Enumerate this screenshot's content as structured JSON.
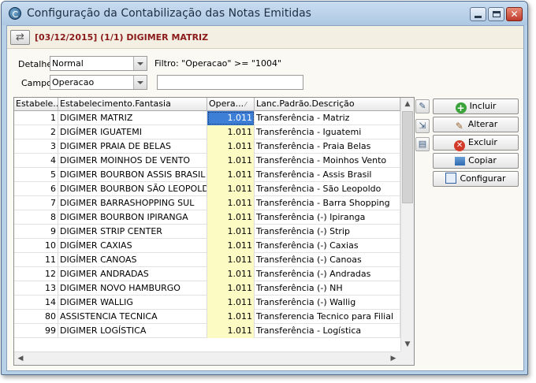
{
  "window": {
    "title": "Configuração da Contabilização das Notas Emitidas"
  },
  "header": {
    "title": "[03/12/2015] (1/1) DIGIMER MATRIZ"
  },
  "filters": {
    "detalhe_label": "Detalhe",
    "detalhe_value": "Normal",
    "filtro_text": "Filtro: \"Operacao\" >= \"1004\"",
    "campo_label": "Campo",
    "campo_value": "Operacao",
    "search_value": ""
  },
  "grid": {
    "columns": [
      "Estabele...",
      "Estabelecimento.Fantasia",
      "Opera...",
      "Lanc.Padrão.Descrição"
    ],
    "rows": [
      {
        "est": "1",
        "fantasia": "DIGIMER MATRIZ",
        "op": "1.011",
        "desc": "Transferência - Matriz"
      },
      {
        "est": "2",
        "fantasia": "DIGÍMER IGUATEMI",
        "op": "1.011",
        "desc": "Transferência - Iguatemi"
      },
      {
        "est": "3",
        "fantasia": "DIGIMER PRAIA DE BELAS",
        "op": "1.011",
        "desc": "Transferência - Praia Belas"
      },
      {
        "est": "4",
        "fantasia": "DIGIMER MOINHOS DE VENTO",
        "op": "1.011",
        "desc": "Transferência - Moinhos Vento"
      },
      {
        "est": "5",
        "fantasia": "DIGIMER BOURBON ASSIS BRASIL",
        "op": "1.011",
        "desc": "Transferência - Assis Brasil"
      },
      {
        "est": "6",
        "fantasia": "DIGIMER BOURBON SÃO LEOPOLDO",
        "op": "1.011",
        "desc": "Transferência - São Leopoldo"
      },
      {
        "est": "7",
        "fantasia": "DIGIMER BARRASHOPPING SUL",
        "op": "1.011",
        "desc": "Transferência - Barra Shopping"
      },
      {
        "est": "8",
        "fantasia": "DIGIMER BOURBON IPIRANGA",
        "op": "1.011",
        "desc": "Transferência (-) Ipiranga"
      },
      {
        "est": "9",
        "fantasia": "DIGIMER STRIP CENTER",
        "op": "1.011",
        "desc": "Transferência (-) Strip"
      },
      {
        "est": "10",
        "fantasia": "DIGÍMER CAXIAS",
        "op": "1.011",
        "desc": "Transferência (-) Caxias"
      },
      {
        "est": "11",
        "fantasia": "DIGÍMER CANOAS",
        "op": "1.011",
        "desc": "Transferência (-) Canoas"
      },
      {
        "est": "12",
        "fantasia": "DIGIMER ANDRADAS",
        "op": "1.011",
        "desc": "Transferência (-) Andradas"
      },
      {
        "est": "13",
        "fantasia": "DIGIMER NOVO HAMBURGO",
        "op": "1.011",
        "desc": "Transferência (-) NH"
      },
      {
        "est": "14",
        "fantasia": "DIGIMER WALLIG",
        "op": "1.011",
        "desc": "Transferência (-) Wallig"
      },
      {
        "est": "80",
        "fantasia": "ASSISTENCIA TECNICA",
        "op": "1.011",
        "desc": "Transferencia Tecnico para Filial"
      },
      {
        "est": "99",
        "fantasia": "DIGIMER LOGÍSTICA",
        "op": "1.011",
        "desc": "Transferência - Logística"
      }
    ]
  },
  "buttons": {
    "incluir": "Incluir",
    "alterar": "Alterar",
    "excluir": "Excluir",
    "copiar": "Copiar",
    "configurar": "Configurar"
  }
}
